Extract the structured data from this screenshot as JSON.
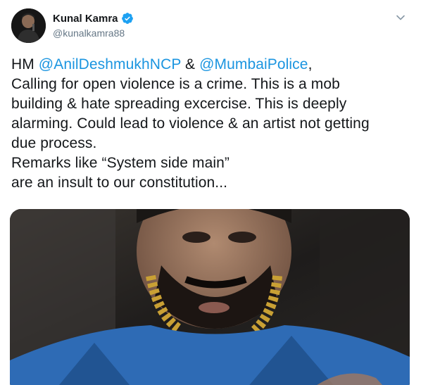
{
  "author": {
    "display_name": "Kunal Kamra",
    "handle": "@kunalkamra88",
    "verified": true
  },
  "icons": {
    "verified": "verified-badge-icon",
    "caret": "chevron-down-icon",
    "avatar": "user-avatar-photo"
  },
  "tweet": {
    "line1_prefix": "HM ",
    "mention1": "@AnilDeshmukhNCP",
    "line1_mid": " & ",
    "mention2": "@MumbaiPolice",
    "line1_suffix": ",",
    "line2": "Calling for open violence is a crime. This is a mob",
    "line3": "building & hate spreading excercise. This is deeply",
    "line4": "alarming. Could lead to violence & an artist not getting",
    "line5": "due process.",
    "line6": "Remarks like “System side main”",
    "line7": "are an insult to our constitution..."
  },
  "colors": {
    "text": "#14171a",
    "secondary": "#657786",
    "link": "#1b95e0",
    "verified": "#1da1f2"
  },
  "media": {
    "type": "video-still"
  }
}
